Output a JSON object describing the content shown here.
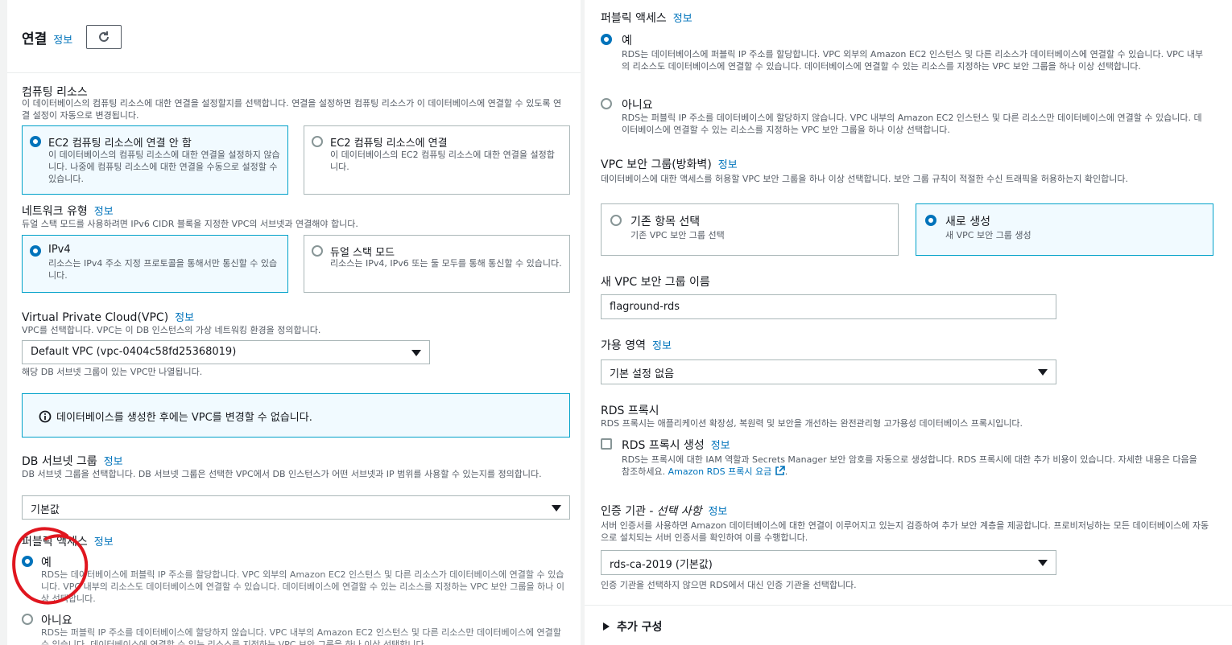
{
  "left": {
    "header": {
      "title": "연결",
      "info": "정보"
    },
    "compute": {
      "label": "컴퓨팅 리소스",
      "desc": "이 데이터베이스의 컴퓨팅 리소스에 대한 연결을 설정할지를 선택합니다. 연결을 설정하면 컴퓨팅 리소스가 이 데이터베이스에 연결할 수 있도록 연결 설정이 자동으로 변경됩니다.",
      "options": [
        {
          "title": "EC2 컴퓨팅 리소스에 연결 안 함",
          "desc": "이 데이터베이스의 컴퓨팅 리소스에 대한 연결을 설정하지 않습니다. 나중에 컴퓨팅 리소스에 대한 연결을 수동으로 설정할 수 있습니다."
        },
        {
          "title": "EC2 컴퓨팅 리소스에 연결",
          "desc": "이 데이터베이스의 EC2 컴퓨팅 리소스에 대한 연결을 설정합니다."
        }
      ]
    },
    "network": {
      "label": "네트워크 유형",
      "info": "정보",
      "desc": "듀얼 스택 모드를 사용하려면 IPv6 CIDR 블록을 지정한 VPC의 서브넷과 연결해야 합니다.",
      "options": [
        {
          "title": "IPv4",
          "desc": "리소스는 IPv4 주소 지정 프로토콜을 통해서만 통신할 수 있습니다."
        },
        {
          "title": "듀얼 스택 모드",
          "desc": "리소스는 IPv4, IPv6 또는 둘 모두를 통해 통신할 수 있습니다."
        }
      ]
    },
    "vpc": {
      "label": "Virtual Private Cloud(VPC)",
      "info": "정보",
      "desc": "VPC를 선택합니다. VPC는 이 DB 인스턴스의 가상 네트워킹 환경을 정의합니다.",
      "value": "Default VPC (vpc-0404c58fd25368019)",
      "hint": "해당 DB 서브넷 그룹이 있는 VPC만 나열됩니다.",
      "alert": "데이터베이스를 생성한 후에는 VPC를 변경할 수 없습니다."
    },
    "subnet": {
      "label": "DB 서브넷 그룹",
      "info": "정보",
      "desc": "DB 서브넷 그룹을 선택합니다. DB 서브넷 그룹은 선택한 VPC에서 DB 인스턴스가 어떤 서브넷과 IP 범위를 사용할 수 있는지를 정의합니다.",
      "value": "기본값"
    },
    "public": {
      "label": "퍼블릭 액세스",
      "info": "정보",
      "yes": "예",
      "yes_desc": "RDS는 데이터베이스에 퍼블릭 IP 주소를 할당합니다. VPC 외부의 Amazon EC2 인스턴스 및 다른 리소스가 데이터베이스에 연결할 수 있습니다. VPC 내부의 리소스도 데이터베이스에 연결할 수 있습니다. 데이터베이스에 연결할 수 있는 리소스를 지정하는 VPC 보안 그룹을 하나 이상 선택합니다.",
      "no": "아니요",
      "no_desc": "RDS는 퍼블릭 IP 주소를 데이터베이스에 할당하지 않습니다. VPC 내부의 Amazon EC2 인스턴스 및 다른 리소스만 데이터베이스에 연결할 수 있습니다. 데이터베이스에 연결할 수 있는 리소스를 지정하는 VPC 보안 그룹을 하나 이상 선택합니다."
    }
  },
  "right": {
    "public": {
      "label": "퍼블릭 액세스",
      "info": "정보",
      "yes": "예",
      "yes_desc": "RDS는 데이터베이스에 퍼블릭 IP 주소를 할당합니다. VPC 외부의 Amazon EC2 인스턴스 및 다른 리소스가 데이터베이스에 연결할 수 있습니다. VPC 내부의 리소스도 데이터베이스에 연결할 수 있습니다. 데이터베이스에 연결할 수 있는 리소스를 지정하는 VPC 보안 그룹을 하나 이상 선택합니다.",
      "no": "아니요",
      "no_desc": "RDS는 퍼블릭 IP 주소를 데이터베이스에 할당하지 않습니다. VPC 내부의 Amazon EC2 인스턴스 및 다른 리소스만 데이터베이스에 연결할 수 있습니다. 데이터베이스에 연결할 수 있는 리소스를 지정하는 VPC 보안 그룹을 하나 이상 선택합니다."
    },
    "sg": {
      "label": "VPC 보안 그룹(방화벽)",
      "info": "정보",
      "desc": "데이터베이스에 대한 액세스를 허용할 VPC 보안 그룹을 하나 이상 선택합니다. 보안 그룹 규칙이 적절한 수신 트래픽을 허용하는지 확인합니다.",
      "options": [
        {
          "title": "기존 항목 선택",
          "desc": "기존 VPC 보안 그룹 선택"
        },
        {
          "title": "새로 생성",
          "desc": "새 VPC 보안 그룹 생성"
        }
      ]
    },
    "sg_name": {
      "label": "새 VPC 보안 그룹 이름",
      "value": "flaground-rds"
    },
    "az": {
      "label": "가용 영역",
      "info": "정보",
      "value": "기본 설정 없음"
    },
    "proxy": {
      "label": "RDS 프록시",
      "desc": "RDS 프록시는 애플리케이션 확장성, 복원력 및 보안을 개선하는 완전관리형 고가용성 데이터베이스 프록시입니다.",
      "checkbox_label": "RDS 프록시 생성",
      "info": "정보",
      "checkbox_desc": "RDS는 프록시에 대한 IAM 역할과 Secrets Manager 보안 암호를 자동으로 생성합니다. RDS 프록시에 대한 추가 비용이 있습니다. 자세한 내용은 다음을 참조하세요.",
      "pricing_link": "Amazon RDS 프록시 요금"
    },
    "ca": {
      "label": "인증 기관 -",
      "label_optional": "선택 사항",
      "info": "정보",
      "desc": "서버 인증서를 사용하면 Amazon 데이터베이스에 대한 연결이 이루어지고 있는지 검증하여 추가 보안 계층을 제공합니다. 프로비저닝하는 모든 데이터베이스에 자동으로 설치되는 서버 인증서를 확인하여 이를 수행합니다.",
      "value": "rds-ca-2019 (기본값)",
      "hint": "인증 기관을 선택하지 않으면 RDS에서 대신 인증 기관을 선택합니다."
    },
    "additional": {
      "label": "추가 구성"
    }
  },
  "annotation": {
    "color": "#e0161f",
    "shape": "hand-drawn red circle around the 예 option"
  }
}
